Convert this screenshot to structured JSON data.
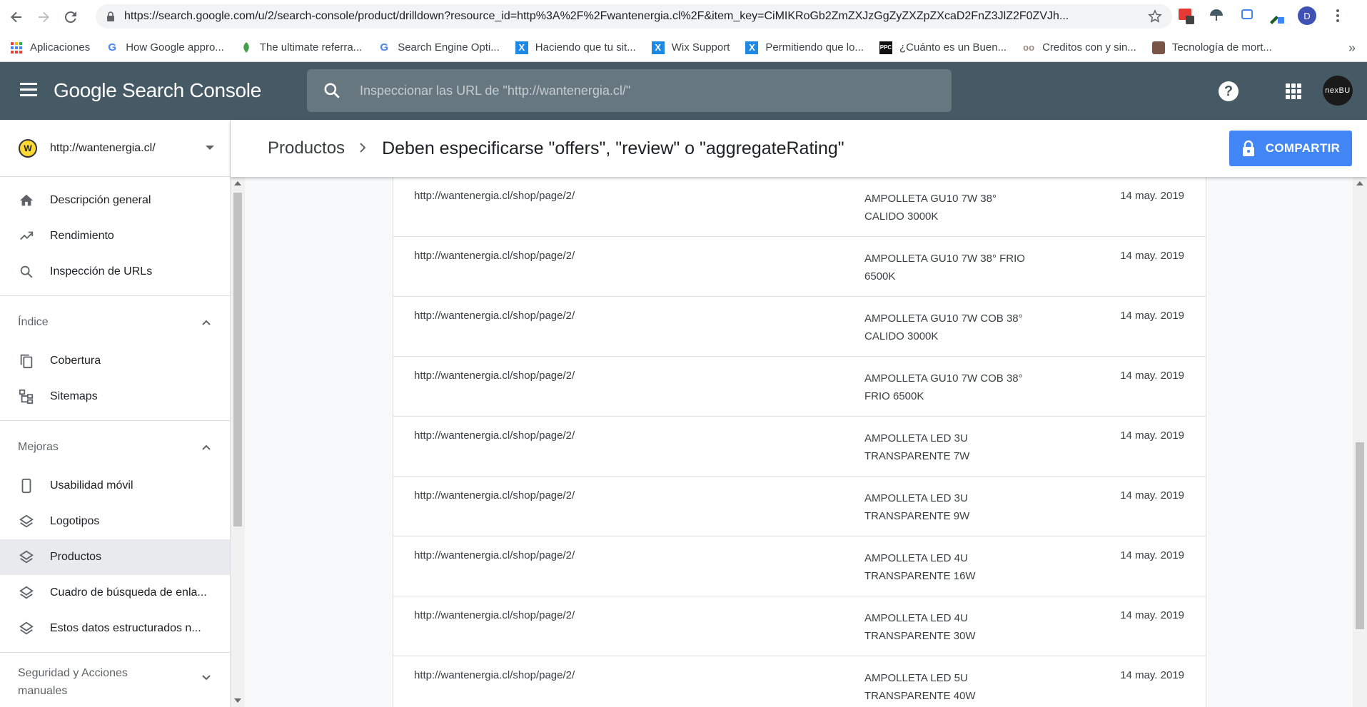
{
  "browser": {
    "url": "https://search.google.com/u/2/search-console/product/drilldown?resource_id=http%3A%2F%2Fwantenergia.cl%2F&item_key=CiMIKRoGb2ZmZXJzGgZyZXZpZXcaD2FnZ3JlZ2F0ZVJh...",
    "profile_initial": "D",
    "ext_badge": "2"
  },
  "bookmarks": [
    {
      "label": "Aplicaciones",
      "icon": "apps-grid-icon"
    },
    {
      "label": "How Google appro...",
      "icon": "google-icon"
    },
    {
      "label": "The ultimate referra...",
      "icon": "leaf-icon"
    },
    {
      "label": "Search Engine Opti...",
      "icon": "google-icon"
    },
    {
      "label": "Haciendo que tu sit...",
      "icon": "wix-icon"
    },
    {
      "label": "Wix Support",
      "icon": "wix-icon"
    },
    {
      "label": "Permitiendo que lo...",
      "icon": "wix-icon"
    },
    {
      "label": "¿Cuánto es un Buen...",
      "icon": "ppc-icon"
    },
    {
      "label": "Creditos con y sin...",
      "icon": "glasses-icon"
    },
    {
      "label": "Tecnología de mort...",
      "icon": "face-icon"
    }
  ],
  "header": {
    "logo": "Google Search Console",
    "search_placeholder": "Inspeccionar las URL de \"http://wantenergia.cl/\"",
    "help_glyph": "?",
    "avatar_text": "nexBU"
  },
  "property": {
    "url": "http://wantenergia.cl/",
    "logo_letter": "W"
  },
  "page": {
    "breadcrumb": "Productos",
    "title": "Deben especificarse \"offers\", \"review\" o \"aggregateRating\"",
    "share_label": "COMPARTIR"
  },
  "sidebar": {
    "top_items": [
      {
        "label": "Descripción general",
        "icon": "home-icon"
      },
      {
        "label": "Rendimiento",
        "icon": "trending-up-icon"
      },
      {
        "label": "Inspección de URLs",
        "icon": "search-icon"
      }
    ],
    "indice": {
      "label": "Índice",
      "items": [
        {
          "label": "Cobertura",
          "icon": "copy-icon"
        },
        {
          "label": "Sitemaps",
          "icon": "sitemap-icon"
        }
      ]
    },
    "mejoras": {
      "label": "Mejoras",
      "items": [
        {
          "label": "Usabilidad móvil",
          "icon": "phone-icon"
        },
        {
          "label": "Logotipos",
          "icon": "layers-icon"
        },
        {
          "label": "Productos",
          "icon": "layers-icon"
        },
        {
          "label": "Cuadro de búsqueda de enla...",
          "icon": "layers-icon"
        },
        {
          "label": "Estos datos estructurados n...",
          "icon": "layers-icon"
        }
      ]
    },
    "seguridad": {
      "label_line1": "Seguridad y Acciones",
      "label_line2": "manuales"
    }
  },
  "table": {
    "rows": [
      {
        "url": "http://wantenergia.cl/shop/page/2/",
        "name_l1": "AMPOLLETA GU10 7W 38°",
        "name_l2": "CALIDO 3000K",
        "date": "14 may. 2019"
      },
      {
        "url": "http://wantenergia.cl/shop/page/2/",
        "name_l1": "AMPOLLETA GU10 7W 38° FRIO",
        "name_l2": "6500K",
        "date": "14 may. 2019"
      },
      {
        "url": "http://wantenergia.cl/shop/page/2/",
        "name_l1": "AMPOLLETA GU10 7W COB 38°",
        "name_l2": "CALIDO 3000K",
        "date": "14 may. 2019"
      },
      {
        "url": "http://wantenergia.cl/shop/page/2/",
        "name_l1": "AMPOLLETA GU10 7W COB 38°",
        "name_l2": "FRIO 6500K",
        "date": "14 may. 2019"
      },
      {
        "url": "http://wantenergia.cl/shop/page/2/",
        "name_l1": "AMPOLLETA LED 3U",
        "name_l2": "TRANSPARENTE 7W",
        "date": "14 may. 2019"
      },
      {
        "url": "http://wantenergia.cl/shop/page/2/",
        "name_l1": "AMPOLLETA LED 3U",
        "name_l2": "TRANSPARENTE 9W",
        "date": "14 may. 2019"
      },
      {
        "url": "http://wantenergia.cl/shop/page/2/",
        "name_l1": "AMPOLLETA LED 4U",
        "name_l2": "TRANSPARENTE 16W",
        "date": "14 may. 2019"
      },
      {
        "url": "http://wantenergia.cl/shop/page/2/",
        "name_l1": "AMPOLLETA LED 4U",
        "name_l2": "TRANSPARENTE 30W",
        "date": "14 may. 2019"
      },
      {
        "url": "http://wantenergia.cl/shop/page/2/",
        "name_l1": "AMPOLLETA LED 5U",
        "name_l2": "TRANSPARENTE 40W",
        "date": "14 may. 2019"
      }
    ]
  },
  "colors": {
    "header_bg": "#455a64",
    "accent": "#4285f4",
    "active_nav": "#e8eaed"
  }
}
